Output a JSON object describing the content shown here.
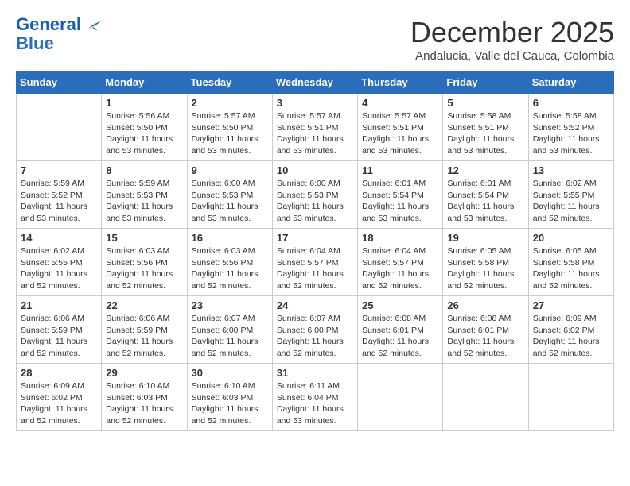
{
  "header": {
    "logo_line1": "General",
    "logo_line2": "Blue",
    "title": "December 2025",
    "subtitle": "Andalucia, Valle del Cauca, Colombia"
  },
  "days_of_week": [
    "Sunday",
    "Monday",
    "Tuesday",
    "Wednesday",
    "Thursday",
    "Friday",
    "Saturday"
  ],
  "weeks": [
    [
      {
        "day": "",
        "info": ""
      },
      {
        "day": "1",
        "info": "Sunrise: 5:56 AM\nSunset: 5:50 PM\nDaylight: 11 hours\nand 53 minutes."
      },
      {
        "day": "2",
        "info": "Sunrise: 5:57 AM\nSunset: 5:50 PM\nDaylight: 11 hours\nand 53 minutes."
      },
      {
        "day": "3",
        "info": "Sunrise: 5:57 AM\nSunset: 5:51 PM\nDaylight: 11 hours\nand 53 minutes."
      },
      {
        "day": "4",
        "info": "Sunrise: 5:57 AM\nSunset: 5:51 PM\nDaylight: 11 hours\nand 53 minutes."
      },
      {
        "day": "5",
        "info": "Sunrise: 5:58 AM\nSunset: 5:51 PM\nDaylight: 11 hours\nand 53 minutes."
      },
      {
        "day": "6",
        "info": "Sunrise: 5:58 AM\nSunset: 5:52 PM\nDaylight: 11 hours\nand 53 minutes."
      }
    ],
    [
      {
        "day": "7",
        "info": "Sunrise: 5:59 AM\nSunset: 5:52 PM\nDaylight: 11 hours\nand 53 minutes."
      },
      {
        "day": "8",
        "info": "Sunrise: 5:59 AM\nSunset: 5:53 PM\nDaylight: 11 hours\nand 53 minutes."
      },
      {
        "day": "9",
        "info": "Sunrise: 6:00 AM\nSunset: 5:53 PM\nDaylight: 11 hours\nand 53 minutes."
      },
      {
        "day": "10",
        "info": "Sunrise: 6:00 AM\nSunset: 5:53 PM\nDaylight: 11 hours\nand 53 minutes."
      },
      {
        "day": "11",
        "info": "Sunrise: 6:01 AM\nSunset: 5:54 PM\nDaylight: 11 hours\nand 53 minutes."
      },
      {
        "day": "12",
        "info": "Sunrise: 6:01 AM\nSunset: 5:54 PM\nDaylight: 11 hours\nand 53 minutes."
      },
      {
        "day": "13",
        "info": "Sunrise: 6:02 AM\nSunset: 5:55 PM\nDaylight: 11 hours\nand 52 minutes."
      }
    ],
    [
      {
        "day": "14",
        "info": "Sunrise: 6:02 AM\nSunset: 5:55 PM\nDaylight: 11 hours\nand 52 minutes."
      },
      {
        "day": "15",
        "info": "Sunrise: 6:03 AM\nSunset: 5:56 PM\nDaylight: 11 hours\nand 52 minutes."
      },
      {
        "day": "16",
        "info": "Sunrise: 6:03 AM\nSunset: 5:56 PM\nDaylight: 11 hours\nand 52 minutes."
      },
      {
        "day": "17",
        "info": "Sunrise: 6:04 AM\nSunset: 5:57 PM\nDaylight: 11 hours\nand 52 minutes."
      },
      {
        "day": "18",
        "info": "Sunrise: 6:04 AM\nSunset: 5:57 PM\nDaylight: 11 hours\nand 52 minutes."
      },
      {
        "day": "19",
        "info": "Sunrise: 6:05 AM\nSunset: 5:58 PM\nDaylight: 11 hours\nand 52 minutes."
      },
      {
        "day": "20",
        "info": "Sunrise: 6:05 AM\nSunset: 5:58 PM\nDaylight: 11 hours\nand 52 minutes."
      }
    ],
    [
      {
        "day": "21",
        "info": "Sunrise: 6:06 AM\nSunset: 5:59 PM\nDaylight: 11 hours\nand 52 minutes."
      },
      {
        "day": "22",
        "info": "Sunrise: 6:06 AM\nSunset: 5:59 PM\nDaylight: 11 hours\nand 52 minutes."
      },
      {
        "day": "23",
        "info": "Sunrise: 6:07 AM\nSunset: 6:00 PM\nDaylight: 11 hours\nand 52 minutes."
      },
      {
        "day": "24",
        "info": "Sunrise: 6:07 AM\nSunset: 6:00 PM\nDaylight: 11 hours\nand 52 minutes."
      },
      {
        "day": "25",
        "info": "Sunrise: 6:08 AM\nSunset: 6:01 PM\nDaylight: 11 hours\nand 52 minutes."
      },
      {
        "day": "26",
        "info": "Sunrise: 6:08 AM\nSunset: 6:01 PM\nDaylight: 11 hours\nand 52 minutes."
      },
      {
        "day": "27",
        "info": "Sunrise: 6:09 AM\nSunset: 6:02 PM\nDaylight: 11 hours\nand 52 minutes."
      }
    ],
    [
      {
        "day": "28",
        "info": "Sunrise: 6:09 AM\nSunset: 6:02 PM\nDaylight: 11 hours\nand 52 minutes."
      },
      {
        "day": "29",
        "info": "Sunrise: 6:10 AM\nSunset: 6:03 PM\nDaylight: 11 hours\nand 52 minutes."
      },
      {
        "day": "30",
        "info": "Sunrise: 6:10 AM\nSunset: 6:03 PM\nDaylight: 11 hours\nand 52 minutes."
      },
      {
        "day": "31",
        "info": "Sunrise: 6:11 AM\nSunset: 6:04 PM\nDaylight: 11 hours\nand 53 minutes."
      },
      {
        "day": "",
        "info": ""
      },
      {
        "day": "",
        "info": ""
      },
      {
        "day": "",
        "info": ""
      }
    ]
  ]
}
